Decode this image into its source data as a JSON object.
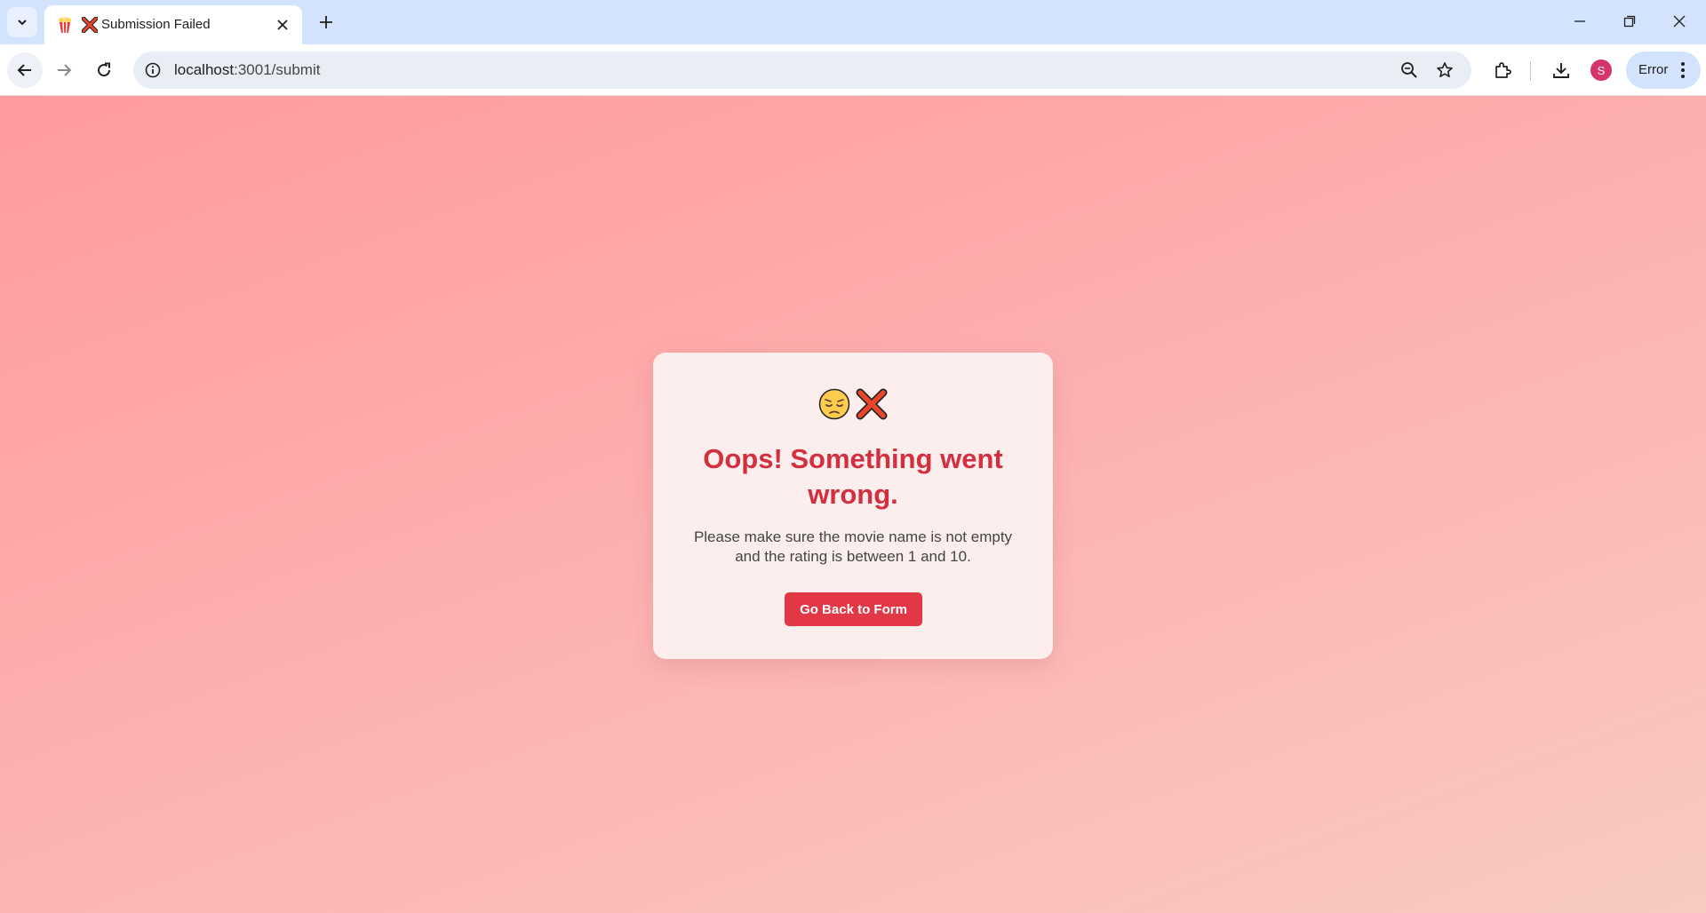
{
  "browser": {
    "tab": {
      "title": "Submission Failed"
    },
    "address_bar": {
      "url_host": "localhost",
      "url_rest": ":3001/submit"
    },
    "profile_initial": "S",
    "error_chip_label": "Error"
  },
  "page": {
    "heading": "Oops! Something went wrong.",
    "message": "Please make sure the movie name is not empty and the rating is between 1 and 10.",
    "button_label": "Go Back to Form"
  },
  "colors": {
    "accent": "#e23744",
    "heading": "#d32f3f",
    "background_start": "#ff9b9e",
    "background_end": "#f8cbc0",
    "card_background": "#fdeeee",
    "avatar": "#d6336c"
  },
  "icons": [
    "tab-search-icon",
    "popcorn-icon",
    "cross-mark-icon",
    "close-icon",
    "plus-icon",
    "minimize-icon",
    "restore-icon",
    "window-close-icon",
    "back-arrow-icon",
    "forward-arrow-icon",
    "reload-icon",
    "info-icon",
    "zoom-icon",
    "star-icon",
    "extensions-icon",
    "download-icon",
    "more-vert-icon",
    "pensive-face-icon"
  ]
}
